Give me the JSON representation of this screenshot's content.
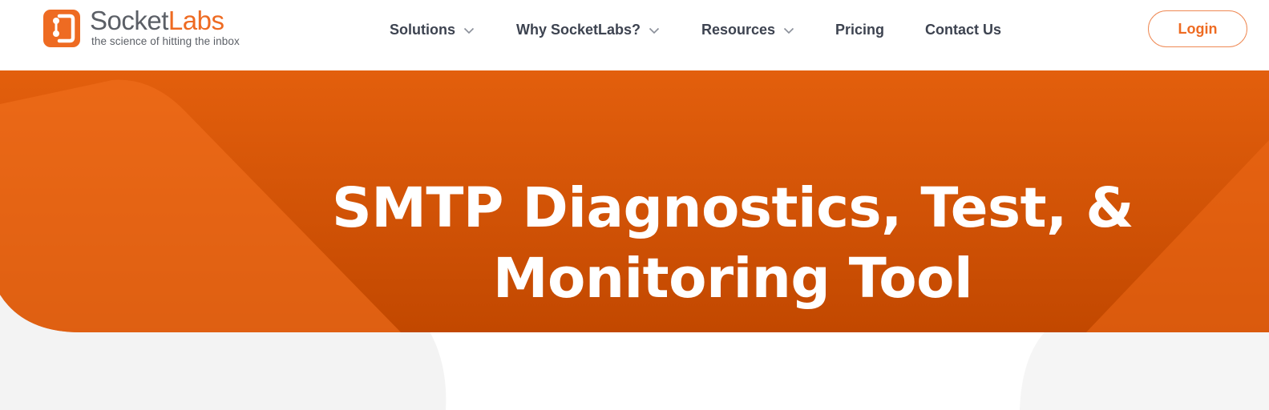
{
  "brand": {
    "name_part1": "Socket",
    "name_part2": "Labs",
    "tagline": "the science of hitting the inbox"
  },
  "nav": {
    "items": [
      {
        "label": "Solutions",
        "has_dropdown": true
      },
      {
        "label": "Why SocketLabs?",
        "has_dropdown": true
      },
      {
        "label": "Resources",
        "has_dropdown": true
      },
      {
        "label": "Pricing",
        "has_dropdown": false
      },
      {
        "label": "Contact Us",
        "has_dropdown": false
      }
    ],
    "login_label": "Login"
  },
  "hero": {
    "title_line1": "SMTP Diagnostics, Test, &",
    "title_line2": "Monitoring Tool"
  },
  "colors": {
    "brand_orange": "#ee6b22",
    "hero_dark": "#c44a00",
    "nav_text": "#3d4350"
  },
  "icons": {
    "logo": "socketlabs-logo-icon",
    "dropdown": "chevron-down-icon"
  }
}
